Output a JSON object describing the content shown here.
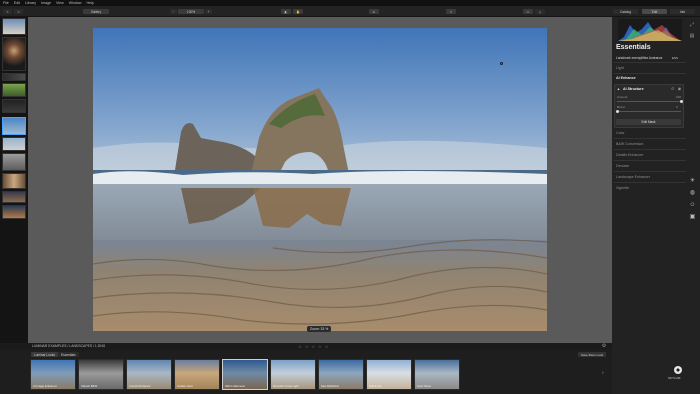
{
  "menubar": {
    "items": [
      "File",
      "Edit",
      "Library",
      "Image",
      "View",
      "Window",
      "Help"
    ]
  },
  "toolbar": {
    "back_label": "<",
    "forward_label": ">",
    "gallery_label": "Gallery",
    "zoom_label": "100%",
    "catalog_label": "Catalog",
    "edit_label": "Edit",
    "info_label": "Info"
  },
  "canvas": {
    "zoom_badge": "Zoom: 33 %"
  },
  "panel": {
    "title": "Essentials",
    "preset_name": "Landmark exemplifies Aotearoa",
    "preset_badge": "ESS",
    "sections": {
      "light": "Light",
      "ai_enhance": "AI Enhance",
      "color": "Color",
      "bw": "B&W Conversion",
      "details": "Details Enhancer",
      "denoise": "Denoise",
      "landscape": "Landscape Enhancer",
      "vignette": "Vignette"
    },
    "ai_structure": {
      "title": "AI Structure",
      "amount_label": "Amount",
      "amount_value": "100",
      "boost_label": "Boost",
      "boost_value": "0",
      "amount_level": 1.0,
      "boost_level": 0.0,
      "edit_mask_label": "Edit Mask"
    }
  },
  "path": "LUMINAR EXAMPLES / LANDSCAPES / 1.DNG",
  "ratings": "☆ ☆ ☆ ☆ ☆",
  "presets": {
    "tabs": [
      "Luminar Looks",
      "Essentials"
    ],
    "save_label": "Save filters Look",
    "items": [
      "AI Image Enhancer",
      "Classic B&W",
      "Colorful Enhance",
      "Golden Hour",
      "Warm Afternoon",
      "Mountain Crisp Light",
      "Sea Reflection",
      "Soft & Airy",
      "Cool Tones"
    ]
  },
  "logo_text": "SKYLUM",
  "colors": {
    "accent": "#4aa3ff",
    "panel_bg": "#222223",
    "canvas_bg": "#5a5a5b"
  }
}
